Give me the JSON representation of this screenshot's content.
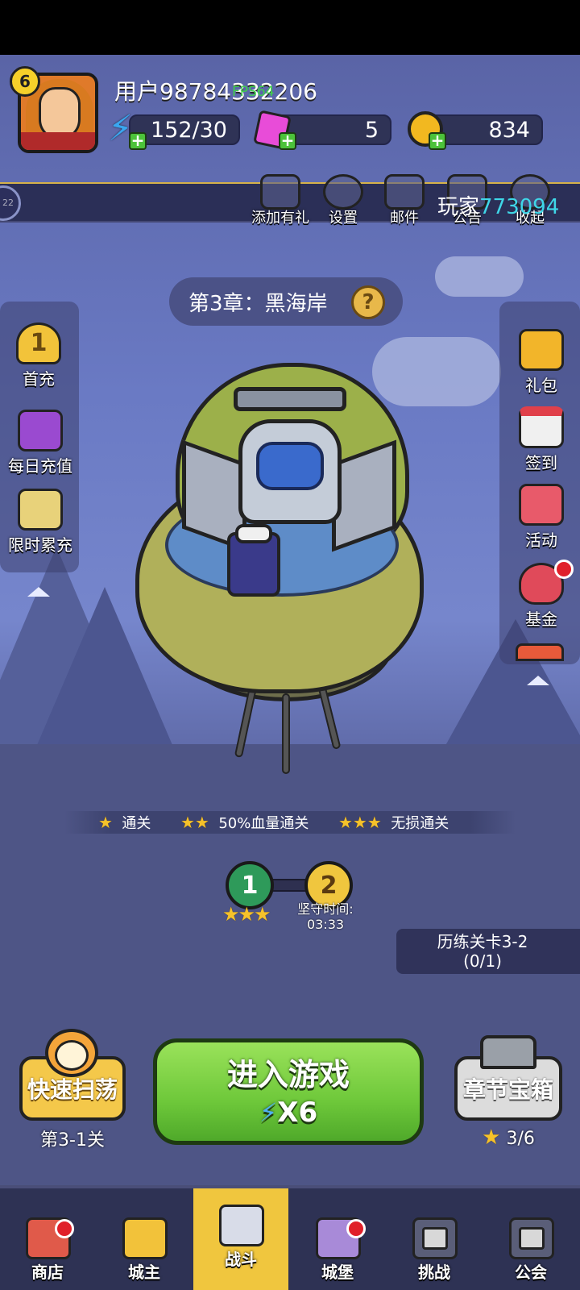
{
  "header": {
    "level": "6",
    "username": "用户98784332206",
    "fps": "FPS64",
    "energy": "152/30",
    "gems": "5",
    "gold": "834"
  },
  "notice": {
    "prefix": "玩家",
    "number": "773094",
    "circle_text": "22"
  },
  "top_menu": [
    {
      "label": "添加有礼",
      "icon": "gift-add-icon"
    },
    {
      "label": "设置",
      "icon": "gear-icon"
    },
    {
      "label": "邮件",
      "icon": "mail-icon"
    },
    {
      "label": "公告",
      "icon": "announcement-icon"
    },
    {
      "label": "收起",
      "icon": "collapse-icon"
    }
  ],
  "left_menu": [
    {
      "label": "首充",
      "badge": "1",
      "icon": "star-medal-icon"
    },
    {
      "label": "每日充值",
      "icon": "treasure-chest-icon"
    },
    {
      "label": "限时累充",
      "icon": "gold-bars-icon"
    }
  ],
  "right_menu": [
    {
      "label": "礼包",
      "icon": "gift-box-icon"
    },
    {
      "label": "签到",
      "icon": "calendar-icon"
    },
    {
      "label": "活动",
      "icon": "event-gift-icon"
    },
    {
      "label": "基金",
      "icon": "money-bag-icon"
    }
  ],
  "chapter": {
    "title": "第3章：黑海岸",
    "help": "?"
  },
  "star_conditions": [
    {
      "stars": "★",
      "label": "通关"
    },
    {
      "stars": "★★",
      "label": "50%血量通关"
    },
    {
      "stars": "★★★",
      "label": "无损通关"
    }
  ],
  "stages": {
    "current": "1",
    "current_stars": "★★★",
    "next": "2",
    "guard_label": "坚守时间:",
    "guard_time": "03:33"
  },
  "trial": {
    "title": "历练关卡3-2",
    "progress": "(0/1)"
  },
  "actions": {
    "sweep_label": "快速扫荡",
    "sweep_stage": "第3-1关",
    "play_label": "进入游戏",
    "play_cost": "X6",
    "chest_label": "章节宝箱",
    "chest_progress": "3/6"
  },
  "nav": [
    {
      "label": "商店",
      "icon": "shop-icon"
    },
    {
      "label": "城主",
      "icon": "crown-icon"
    },
    {
      "label": "战斗",
      "icon": "crossed-swords-icon"
    },
    {
      "label": "城堡",
      "icon": "castle-icon"
    },
    {
      "label": "挑战",
      "icon": "lock-icon"
    },
    {
      "label": "公会",
      "icon": "lock-icon"
    }
  ],
  "colors": {
    "accent_green": "#6ec83a",
    "gold": "#f4c84a",
    "cyan_text": "#3fd7e8",
    "nav_active": "#f0c63e"
  }
}
